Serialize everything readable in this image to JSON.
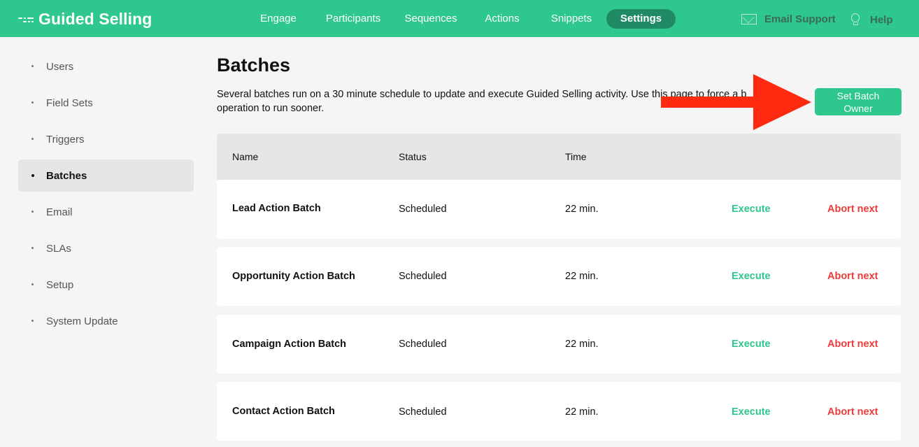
{
  "brand": {
    "title": "Guided Selling",
    "logo_icon": "dashed-lines-logo"
  },
  "nav": {
    "items": [
      {
        "label": "Engage"
      },
      {
        "label": "Participants"
      },
      {
        "label": "Sequences"
      },
      {
        "label": "Actions"
      },
      {
        "label": "Snippets"
      },
      {
        "label": "Settings",
        "active": true
      }
    ]
  },
  "header_right": {
    "support_label": "Email Support",
    "help_label": "Help"
  },
  "sidebar": {
    "items": [
      {
        "label": "Users"
      },
      {
        "label": "Field Sets"
      },
      {
        "label": "Triggers"
      },
      {
        "label": "Batches",
        "active": true
      },
      {
        "label": "Email"
      },
      {
        "label": "SLAs"
      },
      {
        "label": "Setup"
      },
      {
        "label": "System Update"
      }
    ]
  },
  "main": {
    "title": "Batches",
    "description": "Several batches run on a 30 minute schedule to update and execute Guided Selling activity. Use this page to force a b... operation to run sooner.",
    "description_line1": "Several batches run on a 30 minute schedule to update and execute Guided Selling activity. Use this page to force a b",
    "description_line2": "operation to run sooner.",
    "set_owner_label": "Set Batch Owner",
    "set_owner_line1": "Set Batch",
    "set_owner_line2": "Owner"
  },
  "table": {
    "headers": {
      "name": "Name",
      "status": "Status",
      "time": "Time"
    },
    "rows": [
      {
        "name": "Lead Action Batch",
        "status": "Scheduled",
        "time": "22 min.",
        "execute": "Execute",
        "abort": "Abort next"
      },
      {
        "name": "Opportunity Action Batch",
        "status": "Scheduled",
        "time": "22 min.",
        "execute": "Execute",
        "abort": "Abort next"
      },
      {
        "name": "Campaign Action Batch",
        "status": "Scheduled",
        "time": "22 min.",
        "execute": "Execute",
        "abort": "Abort next"
      },
      {
        "name": "Contact Action Batch",
        "status": "Scheduled",
        "time": "22 min.",
        "execute": "Execute",
        "abort": "Abort next"
      }
    ]
  },
  "colors": {
    "brand_green": "#2ec78e",
    "active_nav": "#1f8a64",
    "danger": "#ef3b3b",
    "annotation_arrow": "#ff2a10"
  }
}
